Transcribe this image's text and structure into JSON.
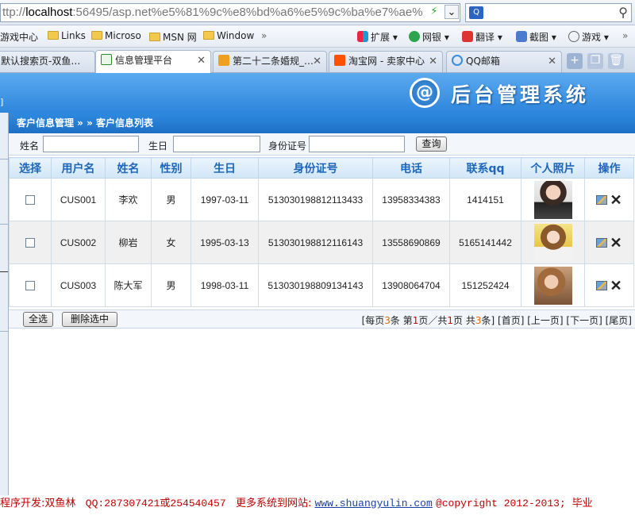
{
  "browser": {
    "address_prefix": "ttp://",
    "address_host": "localhost",
    "address_rest": ":56495/asp.net%e5%81%9c%e8%bd%a6%e5%9c%ba%e7%ae%",
    "search_engine_icon": "Q",
    "bookmarks": [
      "游戏中心",
      "Links",
      "Microso",
      "MSN 网",
      "Window"
    ],
    "bookmarks_more": "»",
    "tools": [
      "扩展",
      "网银",
      "翻译",
      "截图",
      "游戏"
    ],
    "tools_more": "»",
    "tabs": [
      {
        "title": "默认搜索页-双鱼…",
        "active": false
      },
      {
        "title": "信息管理平台",
        "active": true
      },
      {
        "title": "第二十二条婚规_…",
        "active": false
      },
      {
        "title": "淘宝网 - 卖家中心",
        "active": false
      },
      {
        "title": "QQ邮箱",
        "active": false
      }
    ]
  },
  "app": {
    "header_left_mark": "]",
    "logo_glyph": "@",
    "system_title": "后台管理系统",
    "breadcrumb": "客户信息管理 » » 客户信息列表"
  },
  "search": {
    "name_label": "姓名",
    "birthday_label": "生日",
    "idcard_label": "身份证号",
    "query_button": "查询"
  },
  "table": {
    "headers": [
      "选择",
      "用户名",
      "姓名",
      "性别",
      "生日",
      "身份证号",
      "电话",
      "联系qq",
      "个人照片",
      "操作"
    ],
    "rows": [
      {
        "username": "CUS001",
        "name": "李欢",
        "gender": "男",
        "birthday": "1997-03-11",
        "idcard": "513030198812113433",
        "phone": "13958334383",
        "qq": "1414151"
      },
      {
        "username": "CUS002",
        "name": "柳岩",
        "gender": "女",
        "birthday": "1995-03-13",
        "idcard": "513030198812116143",
        "phone": "13558690869",
        "qq": "5165141442"
      },
      {
        "username": "CUS003",
        "name": "陈大军",
        "gender": "男",
        "birthday": "1998-03-11",
        "idcard": "513030198809134143",
        "phone": "13908064704",
        "qq": "151252424"
      }
    ]
  },
  "actions": {
    "select_all": "全选",
    "delete_selected": "删除选中"
  },
  "pager": {
    "p1": "[每页",
    "per_page": "3",
    "p2": "条 第",
    "current": "1",
    "p3": "页／共",
    "total_pages": "1",
    "p4": "页 共",
    "total_items": "3",
    "p5": "条]",
    "first": "[首页]",
    "prev": "[上一页]",
    "next": "[下一页]",
    "last": "[尾页]"
  },
  "footer": {
    "developer": "程序开发:双鱼林",
    "qq": "QQ:287307421或254540457",
    "more": "更多系统到网站:",
    "site": "www.shuangyulin.com",
    "copyright": "@copyright 2012-2013; 毕业"
  }
}
